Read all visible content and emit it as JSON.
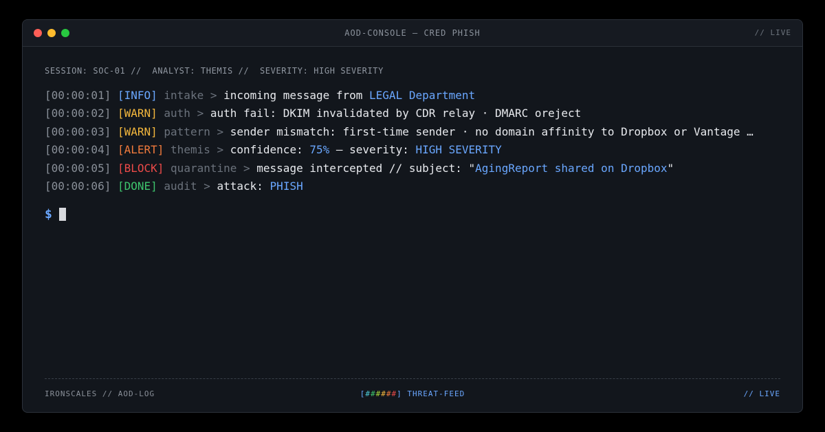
{
  "window": {
    "title": "AOD-CONSOLE — CRED PHISH",
    "live_label": "// LIVE",
    "controls": [
      {
        "name": "close",
        "color": "#ff5f57"
      },
      {
        "name": "minimize",
        "color": "#febc2e"
      },
      {
        "name": "maximize",
        "color": "#28c840"
      }
    ]
  },
  "session": {
    "text": "SESSION: SOC-01 //  ANALYST: THEMIS //  SEVERITY: HIGH SEVERITY"
  },
  "log": [
    {
      "time": "[00:00:01]",
      "level": "[INFO]",
      "level_color": "#6aa7ff",
      "source": "intake >",
      "parts": [
        {
          "text": " incoming message from ",
          "hl": false
        },
        {
          "text": "LEGAL Department",
          "hl": true
        }
      ]
    },
    {
      "time": "[00:00:02]",
      "level": "[WARN]",
      "level_color": "#f5b83d",
      "source": "auth >",
      "parts": [
        {
          "text": " auth fail: DKIM invalidated by CDR relay · DMARC oreject",
          "hl": false
        }
      ]
    },
    {
      "time": "[00:00:03]",
      "level": "[WARN]",
      "level_color": "#f5b83d",
      "source": "pattern >",
      "parts": [
        {
          "text": " sender mismatch: first-time sender · no domain affinity to Dropbox or Vantage …",
          "hl": false
        }
      ]
    },
    {
      "time": "[00:00:04]",
      "level": "[ALERT]",
      "level_color": "#f07a3c",
      "source": "themis >",
      "parts": [
        {
          "text": " confidence: ",
          "hl": false
        },
        {
          "text": "75%",
          "hl": true
        },
        {
          "text": " — severity: ",
          "hl": false
        },
        {
          "text": "HIGH SEVERITY",
          "hl": true
        }
      ]
    },
    {
      "time": "[00:00:05]",
      "level": "[BLOCK]",
      "level_color": "#ec4a48",
      "source": "quarantine >",
      "parts": [
        {
          "text": " message intercepted // subject: \"",
          "hl": false
        },
        {
          "text": "AgingReport shared on Dropbox",
          "hl": true
        },
        {
          "text": "\"",
          "hl": false
        }
      ]
    },
    {
      "time": "[00:00:06]",
      "level": "[DONE]",
      "level_color": "#3ec46d",
      "source": "audit >",
      "parts": [
        {
          "text": " attack: ",
          "hl": false
        },
        {
          "text": "PHISH",
          "hl": true
        }
      ]
    }
  ],
  "prompt": {
    "symbol": "$"
  },
  "footer": {
    "left": "IRONSCALES // AOD-LOG",
    "feed_open": "[",
    "feed_hashes": [
      {
        "char": "#",
        "color": "#4cc9d6"
      },
      {
        "char": "#",
        "color": "#3ec46d"
      },
      {
        "char": "#",
        "color": "#a6d83a"
      },
      {
        "char": "#",
        "color": "#f5b83d"
      },
      {
        "char": "#",
        "color": "#f07a3c"
      },
      {
        "char": "#",
        "color": "#ec4a48"
      }
    ],
    "feed_close": "]",
    "feed_label": " THREAT-FEED",
    "right": "// LIVE"
  }
}
